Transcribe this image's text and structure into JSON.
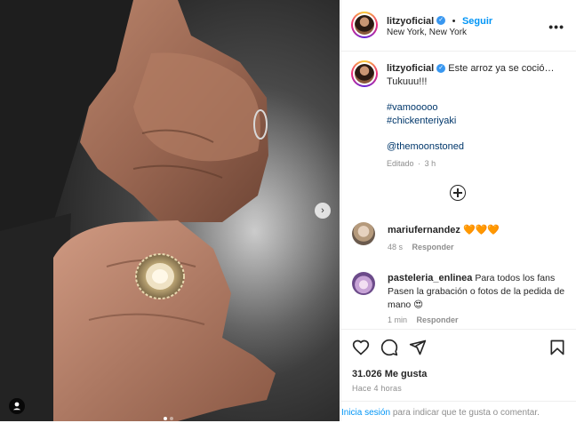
{
  "post": {
    "username": "litzyoficial",
    "follow_label": "Seguir",
    "location": "New York, New York",
    "more_label": "•••"
  },
  "caption": {
    "username": "litzyoficial",
    "text": "Este arroz ya se coció… Tukuuu!!!",
    "hashtags": [
      "#vamooooo",
      "#chickenteriyaki"
    ],
    "mention": "@themoonstoned",
    "edited": "Editado",
    "edited_time": "3 h"
  },
  "comments": [
    {
      "username": "mariufernandez",
      "text": "🧡🧡🧡",
      "time": "48 s",
      "reply_label": "Responder"
    },
    {
      "username": "pasteleria_enlinea",
      "text": "Para todos los fans Pasen la grabación o fotos de la pedida de mano 😍",
      "time": "1 min",
      "reply_label": "Responder"
    }
  ],
  "stats": {
    "likes": "31.026 Me gusta",
    "posted": "Hace 4 horas"
  },
  "login_bar": {
    "link": "Inicia sesión",
    "text": "para indicar que te gusta o comentar."
  },
  "icons": {
    "like": "heart-icon",
    "comment": "comment-icon",
    "share": "share-icon",
    "save": "bookmark-icon",
    "load_more": "plus-circle-icon",
    "next": "chevron-right-icon",
    "user_tag": "user-icon"
  },
  "colors": {
    "link": "#0095f6",
    "hashtag": "#00376b",
    "verified": "#3897f0",
    "muted": "#8e8e8e"
  },
  "carousel": {
    "count": 2,
    "active": 1
  }
}
